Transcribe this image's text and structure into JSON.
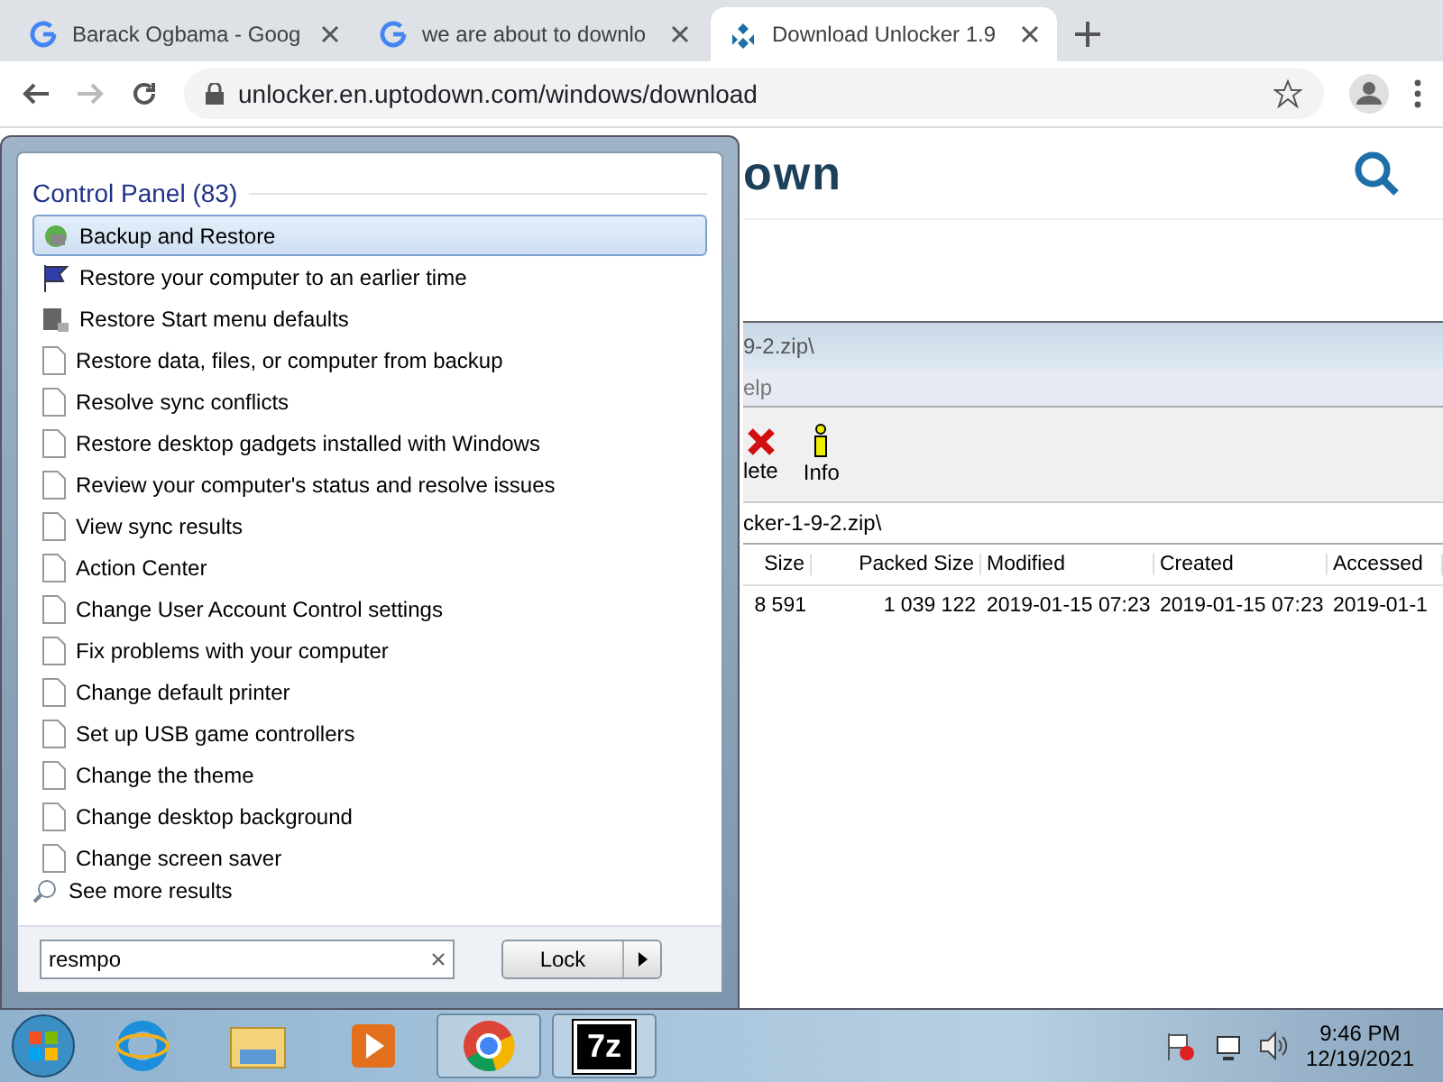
{
  "browser": {
    "tabs": [
      {
        "title": "Barack Ogbama - Goog",
        "kind": "google",
        "selected": false
      },
      {
        "title": "we are about to downlo",
        "kind": "google",
        "selected": false
      },
      {
        "title": "Download Unlocker 1.9",
        "kind": "uptodown",
        "selected": true
      }
    ],
    "url": "unlocker.en.uptodown.com/windows/download"
  },
  "page": {
    "logo_text": "own"
  },
  "archive_window": {
    "title": "9-2.zip\\",
    "menu": [
      "elp"
    ],
    "toolbar": [
      {
        "label": "lete",
        "kind": "delete"
      },
      {
        "label": "Info",
        "kind": "info"
      }
    ],
    "path": "cker-1-9-2.zip\\",
    "columns": [
      "Size",
      "Packed Size",
      "Modified",
      "Created",
      "Accessed"
    ],
    "rows": [
      [
        "8 591",
        "1 039 122",
        "2019-01-15 07:23",
        "2019-01-15 07:23",
        "2019-01-1"
      ]
    ]
  },
  "start_menu": {
    "group_title": "Control Panel (83)",
    "items": [
      {
        "label": "Backup and Restore",
        "kind": "backup",
        "selected": true
      },
      {
        "label": "Restore your computer to an earlier time",
        "kind": "flag",
        "selected": false
      },
      {
        "label": "Restore Start menu defaults",
        "kind": "defaults",
        "selected": false
      },
      {
        "label": "Restore data, files, or computer from backup",
        "kind": "page",
        "selected": false
      },
      {
        "label": "Resolve sync conflicts",
        "kind": "page",
        "selected": false
      },
      {
        "label": "Restore desktop gadgets installed with Windows",
        "kind": "page",
        "selected": false
      },
      {
        "label": "Review your computer's status and resolve issues",
        "kind": "page",
        "selected": false
      },
      {
        "label": "View sync results",
        "kind": "page",
        "selected": false
      },
      {
        "label": "Action Center",
        "kind": "page",
        "selected": false
      },
      {
        "label": "Change User Account Control settings",
        "kind": "page",
        "selected": false
      },
      {
        "label": "Fix problems with your computer",
        "kind": "page",
        "selected": false
      },
      {
        "label": "Change default printer",
        "kind": "page",
        "selected": false
      },
      {
        "label": "Set up USB game controllers",
        "kind": "page",
        "selected": false
      },
      {
        "label": "Change the theme",
        "kind": "page",
        "selected": false
      },
      {
        "label": "Change desktop background",
        "kind": "page",
        "selected": false
      },
      {
        "label": "Change screen saver",
        "kind": "page",
        "selected": false
      }
    ],
    "see_more": "See more results",
    "search_value": "resmpo",
    "power_button": "Lock"
  },
  "taskbar": {
    "apps": [
      {
        "kind": "ie",
        "active": false
      },
      {
        "kind": "explorer",
        "active": false
      },
      {
        "kind": "media",
        "active": false
      },
      {
        "kind": "chrome",
        "active": true
      },
      {
        "kind": "sevenzip",
        "active": true,
        "label": "7z"
      }
    ],
    "time": "9:46 PM",
    "date": "12/19/2021"
  }
}
